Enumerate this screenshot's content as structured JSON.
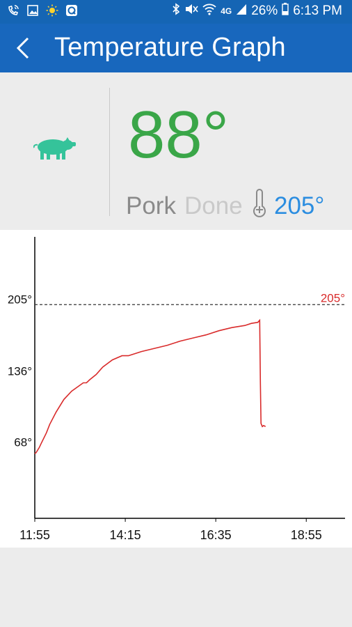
{
  "status_bar": {
    "battery": "26%",
    "time": "6:13 PM",
    "network": "4G",
    "icons": [
      "wifi-call-icon",
      "image-icon",
      "sun-icon",
      "app-icon",
      "bluetooth-icon",
      "mute-icon",
      "wifi-icon",
      "signal-icon",
      "battery-icon"
    ]
  },
  "app_bar": {
    "title": "Temperature Graph",
    "back_icon": "chevron-left-icon"
  },
  "summary": {
    "animal_icon": "pig-icon",
    "current_temp": "88°",
    "meat": "Pork",
    "doneness": "Done",
    "thermometer_icon": "thermometer-icon",
    "target_temp": "205°"
  },
  "colors": {
    "appbar": "#1867bd",
    "current_temp": "#3aa648",
    "target_temp": "#2b8de0",
    "series_line": "#d92b2b",
    "pig": "#35c39a"
  },
  "chart_data": {
    "type": "line",
    "y_ticks": [
      "205°",
      "136°",
      "68°"
    ],
    "x_ticks": [
      "11:55",
      "14:15",
      "16:35",
      "18:55"
    ],
    "threshold": {
      "value": 205,
      "label": "205°"
    },
    "ylim": [
      0,
      270
    ],
    "xlim_minutes": [
      715,
      1195
    ],
    "series": [
      {
        "x": [
          715,
          717,
          722,
          725,
          733,
          738,
          748,
          760,
          772,
          790,
          795,
          800,
          810,
          820,
          835,
          850,
          860,
          870,
          880,
          900,
          920,
          940,
          960,
          980,
          1000,
          1020,
          1040,
          1050,
          1060,
          1063,
          1064,
          1065,
          1067,
          1069,
          1072
        ],
        "y": [
          62,
          63,
          68,
          72,
          82,
          90,
          102,
          114,
          122,
          130,
          130,
          133,
          138,
          145,
          152,
          156,
          156,
          158,
          160,
          163,
          166,
          170,
          173,
          176,
          180,
          183,
          185,
          187,
          188,
          190,
          130,
          91,
          88,
          89,
          88
        ]
      }
    ]
  }
}
